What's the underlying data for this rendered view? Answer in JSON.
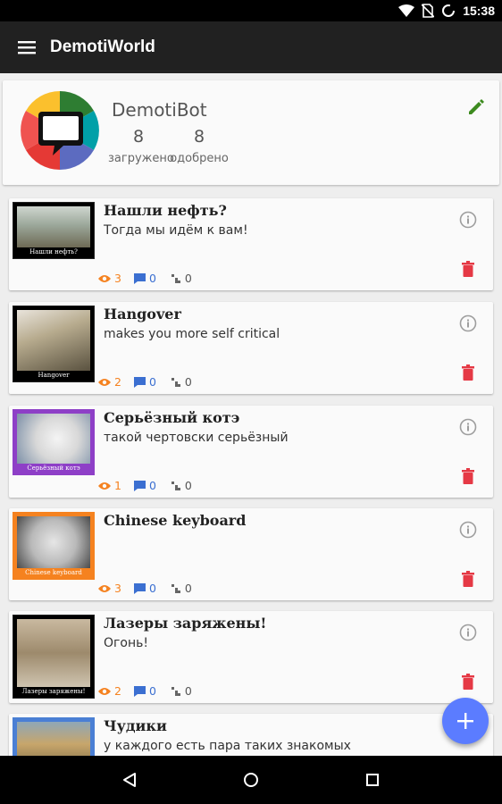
{
  "status_bar": {
    "time": "15:38",
    "icons": [
      "wifi-icon",
      "no-sim-icon",
      "battery-charging-icon"
    ]
  },
  "app_bar": {
    "title": "DemotiWorld",
    "menu_icon": "hamburger-menu-icon"
  },
  "profile": {
    "name": "DemotiBot",
    "uploaded_count": "8",
    "uploaded_label": "загружено",
    "approved_count": "8",
    "approved_label": "одобрено",
    "edit_icon": "pencil-icon"
  },
  "posts": [
    {
      "title": "Нашли нефть?",
      "subtitle": "Тогда мы идём к вам!",
      "thumb_caption": "Нашли нефть?",
      "views": "3",
      "comments": "0",
      "likes": "0",
      "border_color": "#222222",
      "caption_bg": "#000000"
    },
    {
      "title": "Hangover",
      "subtitle": "makes you more self critical",
      "thumb_caption": "Hangover",
      "views": "2",
      "comments": "0",
      "likes": "0",
      "border_color": "#222222",
      "caption_bg": "#000000"
    },
    {
      "title": "Серьёзный котэ",
      "subtitle": "такой чертовски серьёзный",
      "thumb_caption": "Серьёзный котэ",
      "views": "1",
      "comments": "0",
      "likes": "0",
      "border_color": "#8e3fc7",
      "caption_bg": "#8e3fc7"
    },
    {
      "title": "Chinese keyboard",
      "subtitle": "",
      "thumb_caption": "Chinese keyboard",
      "views": "3",
      "comments": "0",
      "likes": "0",
      "border_color": "#f5821f",
      "caption_bg": "#f5821f"
    },
    {
      "title": "Лазеры заряжены!",
      "subtitle": "Огонь!",
      "thumb_caption": "Лазеры заряжены!",
      "views": "2",
      "comments": "0",
      "likes": "0",
      "border_color": "#222222",
      "caption_bg": "#000000"
    },
    {
      "title": "Чудики",
      "subtitle": "у каждого есть пара таких знакомых",
      "thumb_caption": "",
      "views": "",
      "comments": "",
      "likes": "",
      "border_color": "#4a7fd4",
      "caption_bg": "#4a7fd4"
    }
  ],
  "colors": {
    "app_bar": "#212121",
    "views": "#f58220",
    "comments": "#3b6fd1",
    "delete": "#e53945",
    "edit": "#3d8b1f",
    "fab": "#5b7cff"
  },
  "fab_icon": "plus-icon",
  "nav_bar": {
    "icons": [
      "back-icon",
      "home-icon",
      "recents-icon"
    ]
  }
}
